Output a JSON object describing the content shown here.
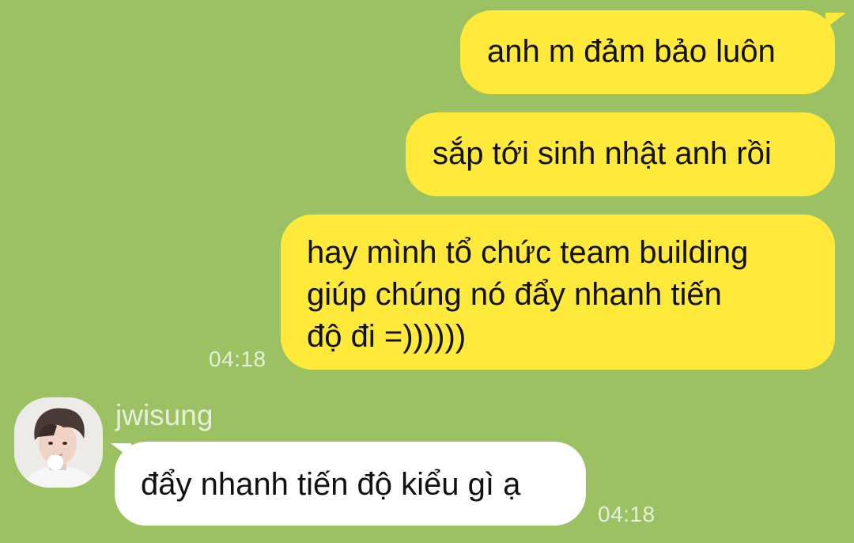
{
  "chat": {
    "messages": [
      {
        "direction": "outgoing",
        "text": "anh m đảm bảo luôn"
      },
      {
        "direction": "outgoing",
        "text": "sắp tới sinh nhật anh rồi"
      },
      {
        "direction": "outgoing",
        "lines": [
          "hay mình tổ chức team building",
          "giúp chúng nó đẩy nhanh tiến",
          "độ đi =))))))"
        ],
        "time": "04:18"
      },
      {
        "direction": "incoming",
        "sender": "jwisung",
        "text": "đẩy nhanh tiến độ kiểu gì ạ",
        "time": "04:18"
      }
    ]
  },
  "colors": {
    "background": "#9bc162",
    "outgoing_bubble": "#ffe93a",
    "incoming_bubble": "#ffffff",
    "meta_text": "#e6efd9"
  },
  "icons": {
    "avatar": "profile-photo"
  }
}
